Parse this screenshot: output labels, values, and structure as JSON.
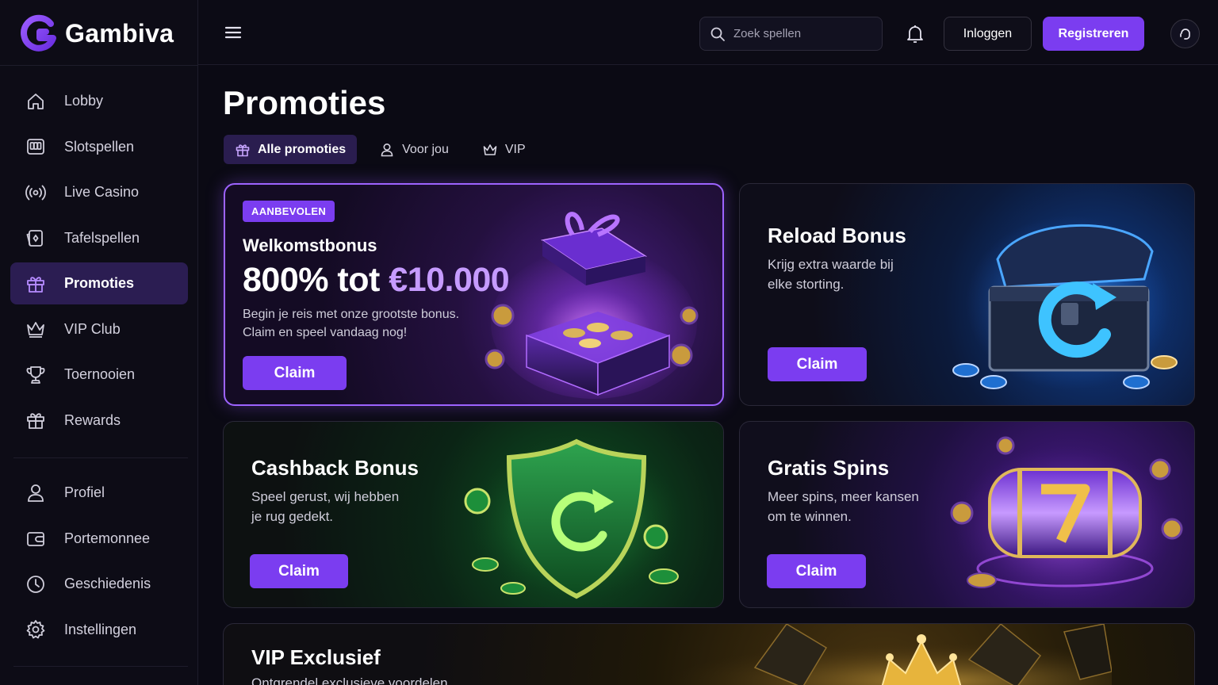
{
  "brand": {
    "name": "Gambiva",
    "accent": "#7b3df0"
  },
  "header": {
    "search_placeholder": "Zoek spellen",
    "login_label": "Inloggen",
    "register_label": "Registreren"
  },
  "sidebar": {
    "items": [
      {
        "label": "Lobby",
        "icon": "home-icon"
      },
      {
        "label": "Slotspellen",
        "icon": "slot-machine-icon"
      },
      {
        "label": "Live Casino",
        "icon": "broadcast-icon"
      },
      {
        "label": "Tafelspellen",
        "icon": "cards-icon"
      },
      {
        "label": "Promoties",
        "icon": "gift-icon",
        "active": true
      },
      {
        "label": "VIP Club",
        "icon": "crown-icon"
      },
      {
        "label": "Toernooien",
        "icon": "trophy-icon"
      },
      {
        "label": "Rewards",
        "icon": "gift-icon"
      }
    ],
    "account_items": [
      {
        "label": "Profiel",
        "icon": "user-icon"
      },
      {
        "label": "Portemonnee",
        "icon": "wallet-icon"
      },
      {
        "label": "Geschiedenis",
        "icon": "clock-icon"
      },
      {
        "label": "Instellingen",
        "icon": "gear-icon"
      }
    ]
  },
  "main": {
    "title": "Promoties",
    "tabs": [
      {
        "label": "Alle promoties",
        "icon": "gift-icon",
        "active": true
      },
      {
        "label": "Voor jou",
        "icon": "user-icon"
      },
      {
        "label": "VIP",
        "icon": "crown-icon"
      }
    ],
    "promos": {
      "welcome": {
        "badge": "AANBEVOLEN",
        "title": "Welkomstbonus",
        "amount_prefix": "800% tot ",
        "amount_value": "€10.000",
        "desc_line1": "Begin je reis met onze grootste bonus.",
        "desc_line2": "Claim en speel vandaag nog!",
        "cta": "Claim"
      },
      "reload": {
        "title": "Reload Bonus",
        "desc_line1": "Krijg extra waarde bij",
        "desc_line2": "elke storting.",
        "cta": "Claim"
      },
      "cashback": {
        "title": "Cashback Bonus",
        "desc_line1": "Speel gerust, wij hebben",
        "desc_line2": "je rug gedekt.",
        "cta": "Claim"
      },
      "spins": {
        "title": "Gratis Spins",
        "desc_line1": "Meer spins, meer kansen",
        "desc_line2": "om te winnen.",
        "cta": "Claim"
      },
      "vip": {
        "title": "VIP Exclusief",
        "desc_line1": "Ontgrendel exclusieve voordelen"
      }
    }
  }
}
